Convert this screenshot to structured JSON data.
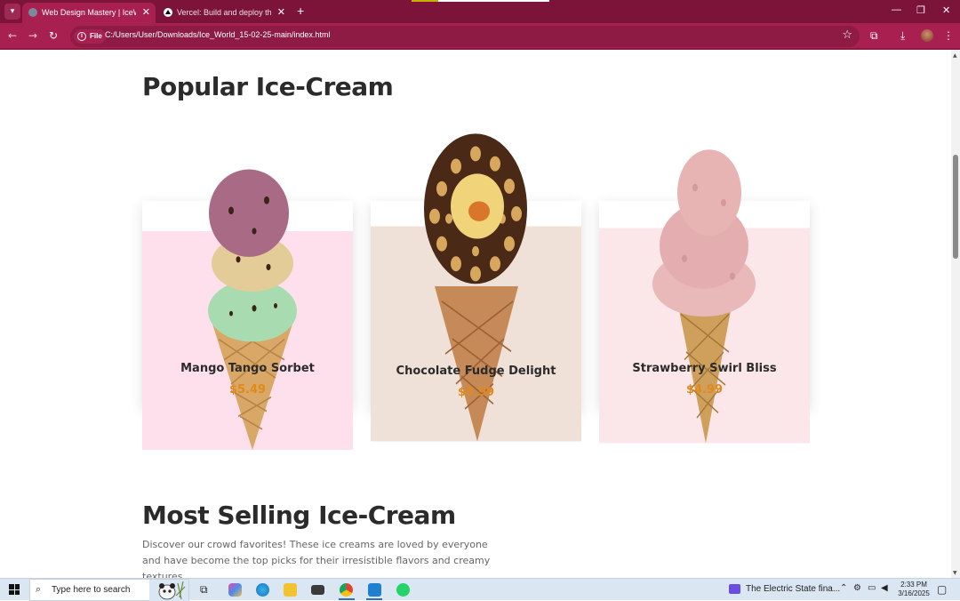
{
  "browser": {
    "tabs": [
      {
        "label": "Web Design Mastery | IceWorld",
        "active": true
      },
      {
        "label": "Vercel: Build and deploy the be",
        "active": false
      }
    ],
    "new_tab": "+",
    "address": {
      "chip": "File",
      "url": "C:/Users/User/Downloads/Ice_World_15-02-25-main/index.html"
    },
    "accent": "#a8204f",
    "titlebar_color": "#7b1438"
  },
  "page": {
    "popular_title": "Popular Ice-Cream",
    "cards": [
      {
        "name": "Mango Tango Sorbet",
        "price": "$5.49",
        "bg": "#fde0ec"
      },
      {
        "name": "Chocolate Fudge Delight",
        "price": "$5.99",
        "bg": "#efe0d8"
      },
      {
        "name": "Strawberry Swirl Bliss",
        "price": "$4.99",
        "bg": "#fbe6ea"
      }
    ],
    "most_title": "Most Selling Ice-Cream",
    "most_desc": "Discover our crowd favorites! These ice creams are loved by everyone and have become the top picks for their irresistible flavors and creamy textures.",
    "price_color": "#e08a1e"
  },
  "taskbar": {
    "search_placeholder": "Type here to search",
    "notification": "The Electric State fina...",
    "time": "2:33 PM",
    "date": "3/16/2025"
  }
}
